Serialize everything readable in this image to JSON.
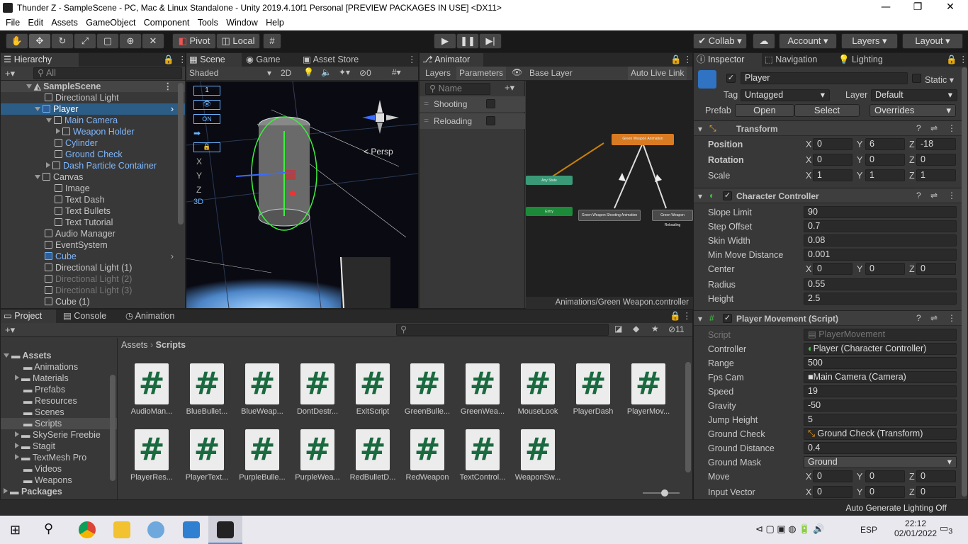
{
  "window": {
    "title": "Thunder Z - SampleScene - PC, Mac & Linux Standalone - Unity 2019.4.10f1 Personal [PREVIEW PACKAGES IN USE] <DX11>"
  },
  "menu": [
    "File",
    "Edit",
    "Assets",
    "GameObject",
    "Component",
    "Tools",
    "Window",
    "Help"
  ],
  "toolbar": {
    "pivot": "Pivot",
    "local": "Local",
    "collab": "Collab",
    "account": "Account",
    "layers": "Layers",
    "layout": "Layout"
  },
  "hierarchy": {
    "tab": "Hierarchy",
    "search": "All",
    "scene": "SampleScene",
    "items": [
      "Directional Light",
      "Player",
      "Main Camera",
      "Weapon Holder",
      "Cylinder",
      "Ground Check",
      "Dash Particle Container",
      "Canvas",
      "Image",
      "Text Dash",
      "Text Bullets",
      "Text Tutorial",
      "Audio Manager",
      "EventSystem",
      "Cube",
      "Directional Light (1)",
      "Directional Light (2)",
      "Directional Light (3)",
      "Cube (1)"
    ]
  },
  "scene": {
    "tabs": [
      "Scene",
      "Game",
      "Asset Store"
    ],
    "shading": "Shaded",
    "mode2d": "2D",
    "gizmo_count": "0",
    "persp": "< Persp",
    "overlay": [
      "1",
      "ON",
      "X",
      "Y",
      "Z",
      "3D"
    ]
  },
  "animator": {
    "tab": "Animator",
    "layers": "Layers",
    "parameters": "Parameters",
    "base": "Base Layer",
    "auto": "Auto Live Link",
    "search": "Name",
    "params": [
      {
        "name": "Shooting"
      },
      {
        "name": "Reloading"
      }
    ],
    "nodes": {
      "green": "Green Weapon Animation",
      "any": "Any State",
      "entry": "Entry",
      "shoot": "Green Weapon Shooting Animation",
      "reload": "Green Weapon Reloading"
    },
    "path": "Animations/Green Weapon.controller"
  },
  "inspector": {
    "tabs": [
      "Inspector",
      "Navigation",
      "Lighting"
    ],
    "name": "Player",
    "static": "Static",
    "tag_label": "Tag",
    "tag": "Untagged",
    "layer_label": "Layer",
    "layer": "Default",
    "prefab": "Prefab",
    "open": "Open",
    "select": "Select",
    "overrides": "Overrides",
    "transform": {
      "title": "Transform",
      "position": "Position",
      "rotation": "Rotation",
      "scale": "Scale",
      "pos": [
        "0",
        "6",
        "-18"
      ],
      "rot": [
        "0",
        "0",
        "0"
      ],
      "scl": [
        "1",
        "1",
        "1"
      ]
    },
    "cc": {
      "title": "Character Controller",
      "rows": [
        [
          "Slope Limit",
          "90"
        ],
        [
          "Step Offset",
          "0.7"
        ],
        [
          "Skin Width",
          "0.08"
        ],
        [
          "Min Move Distance",
          "0.001"
        ]
      ],
      "center_label": "Center",
      "center": [
        "0",
        "0",
        "0"
      ],
      "radius_label": "Radius",
      "radius": "0.55",
      "height_label": "Height",
      "height": "2.5"
    },
    "pm": {
      "title": "Player Movement (Script)",
      "script_label": "Script",
      "script": "PlayerMovement",
      "controller_label": "Controller",
      "controller": "Player (Character Controller)",
      "range_label": "Range",
      "range": "500",
      "fps_label": "Fps Cam",
      "fps": "Main Camera (Camera)",
      "speed_label": "Speed",
      "speed": "19",
      "gravity_label": "Gravity",
      "gravity": "-50",
      "jump_label": "Jump Height",
      "jump": "5",
      "gc_label": "Ground Check",
      "gc": "Ground Check (Transform)",
      "gd_label": "Ground Distance",
      "gd": "0.4",
      "gm_label": "Ground Mask",
      "gm": "Ground",
      "move_label": "Move",
      "move": [
        "0",
        "0",
        "0"
      ],
      "iv_label": "Input Vector",
      "iv": [
        "0",
        "0",
        "0"
      ]
    }
  },
  "project": {
    "tabs": [
      "Project",
      "Console",
      "Animation"
    ],
    "hidden_count": "11",
    "breadcrumb": [
      "Assets",
      "Scripts"
    ],
    "tree": [
      "Assets",
      "Animations",
      "Materials",
      "Prefabs",
      "Resources",
      "Scenes",
      "Scripts",
      "SkySerie Freebie",
      "Stagit",
      "TextMesh Pro",
      "Videos",
      "Weapons",
      "Packages"
    ],
    "scripts": [
      "AudioMan...",
      "BlueBullet...",
      "BlueWeap...",
      "DontDestr...",
      "ExitScript",
      "GreenBulle...",
      "GreenWea...",
      "MouseLook",
      "PlayerDash",
      "PlayerMov...",
      "PlayerRes...",
      "PlayerText...",
      "PurpleBulle...",
      "PurpleWea...",
      "RedBulletD...",
      "RedWeapon",
      "TextControl...",
      "WeaponSw..."
    ]
  },
  "status": {
    "lighting": "Auto Generate Lighting Off"
  },
  "taskbar": {
    "lang": "ESP",
    "time": "22:12",
    "date": "02/01/2022",
    "notif": "3"
  }
}
